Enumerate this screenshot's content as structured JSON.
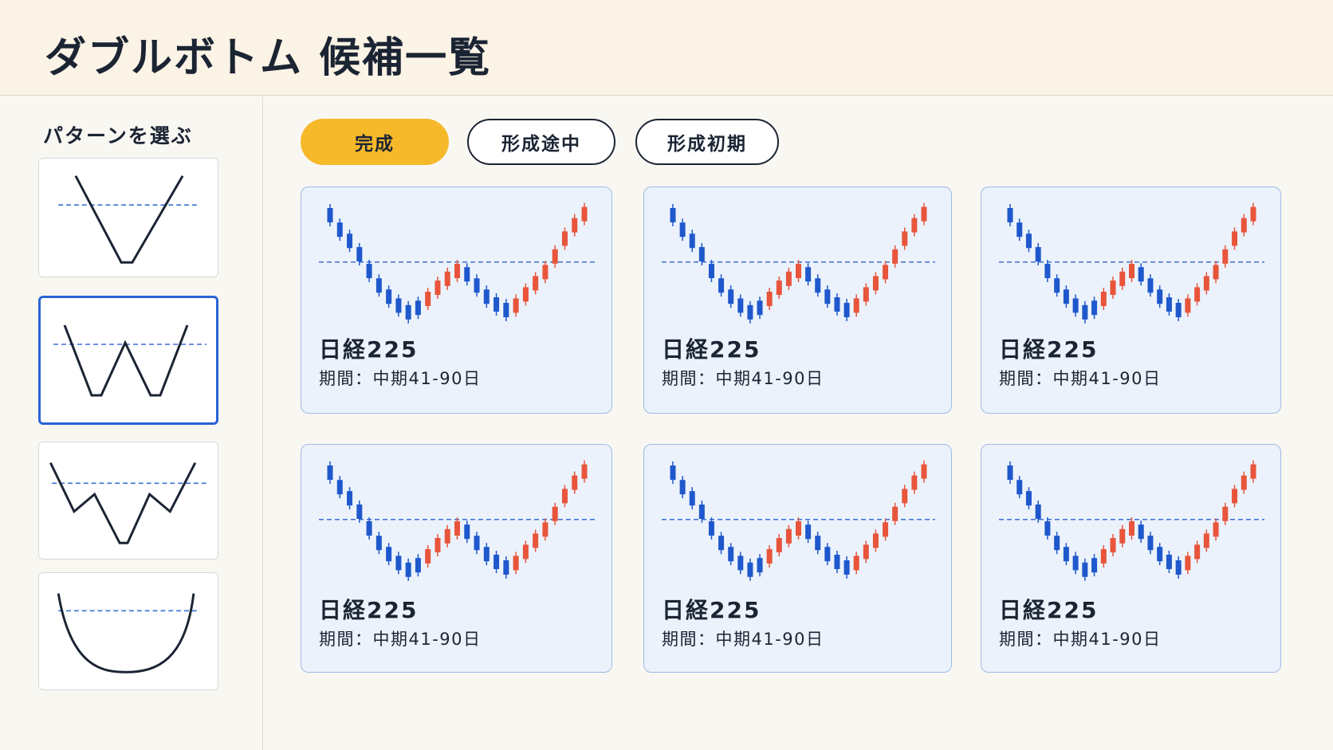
{
  "page_title": "ダブルボトム 候補一覧",
  "sidebar": {
    "title": "パターンを選ぶ",
    "patterns": [
      {
        "icon": "v-bottom-pattern-icon",
        "selected": false
      },
      {
        "icon": "double-bottom-pattern-icon",
        "selected": true
      },
      {
        "icon": "triple-bottom-pattern-icon",
        "selected": false
      },
      {
        "icon": "rounded-bottom-pattern-icon",
        "selected": false
      }
    ]
  },
  "filter_tabs": [
    {
      "label": "完成",
      "active": true
    },
    {
      "label": "形成途中",
      "active": false
    },
    {
      "label": "形成初期",
      "active": false
    }
  ],
  "colors": {
    "up_candle": "#e8553b",
    "down_candle": "#1f58cc",
    "neckline": "#3b6fd4",
    "active_tab": "#f6b92a",
    "selected_border": "#2a64d6"
  },
  "cards": [
    {
      "name": "日経225",
      "period": "期間：中期41-90日"
    },
    {
      "name": "日経225",
      "period": "期間：中期41-90日"
    },
    {
      "name": "日経225",
      "period": "期間：中期41-90日"
    },
    {
      "name": "日経225",
      "period": "期間：中期41-90日"
    },
    {
      "name": "日経225",
      "period": "期間：中期41-90日"
    },
    {
      "name": "日経225",
      "period": "期間：中期41-90日"
    }
  ]
}
